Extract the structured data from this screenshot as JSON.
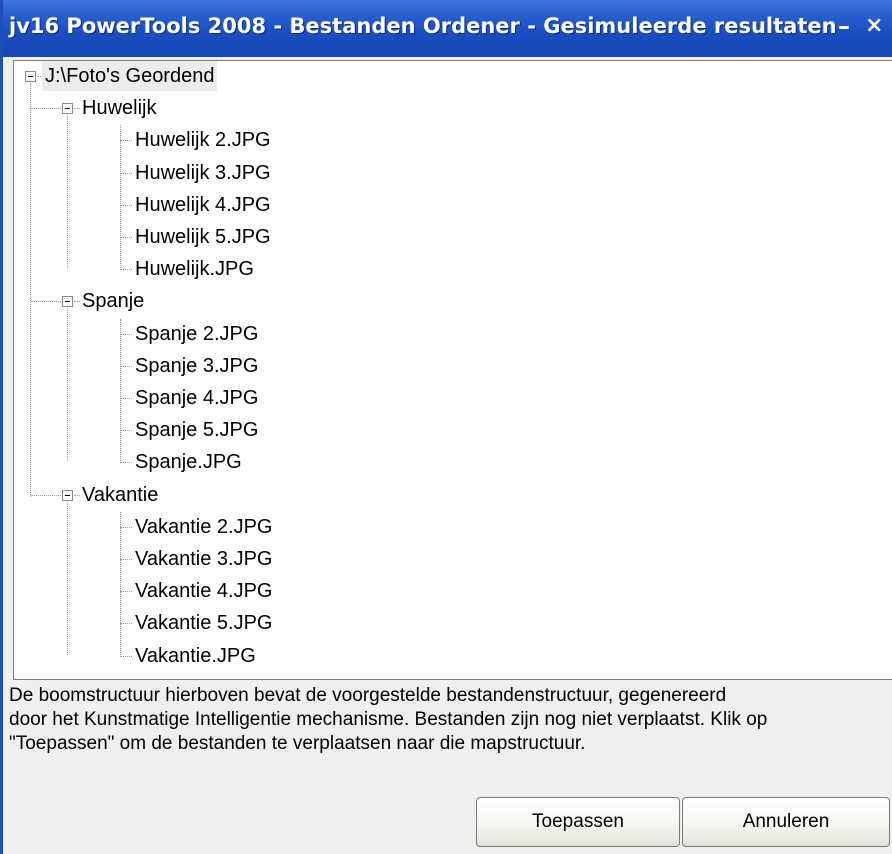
{
  "window": {
    "title": "jv16 PowerTools 2008 - Bestanden Ordener - Gesimuleerde resultaten",
    "minimize_glyph": "–",
    "close_glyph": "×"
  },
  "tree": {
    "root": "J:\\Foto's Geordend",
    "folders": [
      {
        "name": "Huwelijk",
        "files": [
          "Huwelijk 2.JPG",
          "Huwelijk 3.JPG",
          "Huwelijk 4.JPG",
          "Huwelijk 5.JPG",
          "Huwelijk.JPG"
        ]
      },
      {
        "name": "Spanje",
        "files": [
          "Spanje 2.JPG",
          "Spanje 3.JPG",
          "Spanje 4.JPG",
          "Spanje 5.JPG",
          "Spanje.JPG"
        ]
      },
      {
        "name": "Vakantie",
        "files": [
          "Vakantie 2.JPG",
          "Vakantie 3.JPG",
          "Vakantie 4.JPG",
          "Vakantie 5.JPG",
          "Vakantie.JPG"
        ]
      }
    ]
  },
  "description": {
    "lines": [
      "De boomstructuur hierboven bevat de voorgestelde bestandenstructuur, gegenereerd",
      "door het Kunstmatige Intelligentie mechanisme. Bestanden zijn nog niet verplaatst. Klik op",
      "\"Toepassen\" om de bestanden te verplaatsen naar die mapstructuur."
    ]
  },
  "buttons": {
    "apply": "Toepassen",
    "cancel": "Annuleren"
  },
  "colors": {
    "titlebar": "#1a4fc2",
    "window_border": "#1e4fb4"
  }
}
